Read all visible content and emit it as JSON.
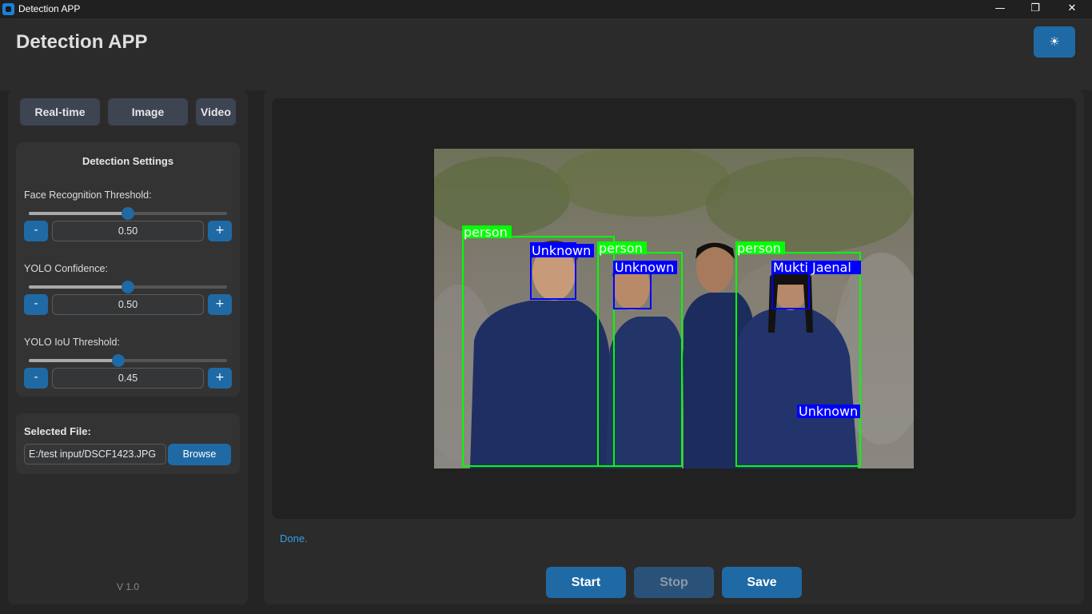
{
  "window": {
    "title": "Detection APP",
    "controls": [
      "—",
      "❐",
      "✕"
    ]
  },
  "header": {
    "title": "Detection APP",
    "theme_toggle_icon": "☀"
  },
  "sidebar": {
    "tabs": [
      {
        "label": "Real-time"
      },
      {
        "label": "Image"
      },
      {
        "label": "Video"
      }
    ],
    "settings": {
      "title": "Detection Settings",
      "items": [
        {
          "label": "Face Recognition Threshold:",
          "value": "0.50",
          "fraction": 0.5,
          "minus": "-",
          "plus": "+"
        },
        {
          "label": "YOLO Confidence:",
          "value": "0.50",
          "fraction": 0.5,
          "minus": "-",
          "plus": "+"
        },
        {
          "label": "YOLO IoU Threshold:",
          "value": "0.45",
          "fraction": 0.45,
          "minus": "-",
          "plus": "+"
        }
      ]
    },
    "file": {
      "title": "Selected File:",
      "path": "E:/test input/DSCF1423.JPG",
      "browse_label": "Browse"
    },
    "version": "V 1.0"
  },
  "main": {
    "detections": [
      {
        "class": "person",
        "name": "Unknown"
      },
      {
        "class": "person",
        "name": "Unknown"
      },
      {
        "class": "person",
        "name": "Mukti Jaenal"
      },
      {
        "extra_label": "Unknown"
      }
    ],
    "status": "Done.",
    "buttons": {
      "start": "Start",
      "stop": "Stop",
      "save": "Save"
    }
  },
  "colors": {
    "accent": "#1f6aa5",
    "person_box": "#00ff00",
    "face_box": "#0000ff",
    "status_text": "#2ea0e6"
  }
}
